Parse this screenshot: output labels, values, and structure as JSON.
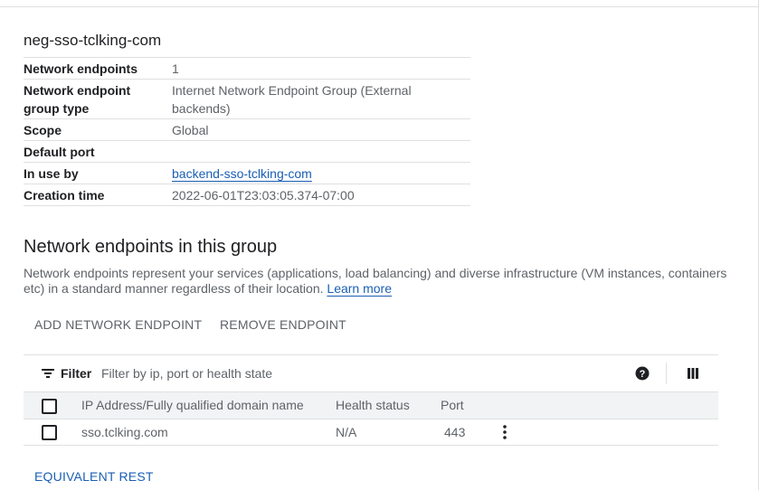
{
  "neg_name": "neg-sso-tclking-com",
  "details": [
    {
      "label": "Network endpoints",
      "value": "1"
    },
    {
      "label": "Network endpoint group type",
      "value": "Internet Network Endpoint Group (External backends)"
    },
    {
      "label": "Scope",
      "value": "Global"
    },
    {
      "label": "Default port",
      "value": ""
    },
    {
      "label": "In use by",
      "value": "backend-sso-tclking-com"
    },
    {
      "label": "Creation time",
      "value": "2022-06-01T23:03:05.374-07:00"
    }
  ],
  "section": {
    "title": "Network endpoints in this group",
    "description": "Network endpoints represent your services (applications, load balancing) and diverse infrastructure (VM instances, containers etc) in a standard manner regardless of their location.",
    "learn_more": "Learn more"
  },
  "actions": {
    "add": "ADD NETWORK ENDPOINT",
    "remove": "REMOVE ENDPOINT"
  },
  "filter": {
    "label": "Filter",
    "placeholder": "Filter by ip, port or health state",
    "icons": {
      "filter": "filter-icon",
      "help": "help-icon",
      "columns": "column-display-icon"
    }
  },
  "table": {
    "columns": [
      "IP Address/Fully qualified domain name",
      "Health status",
      "Port"
    ],
    "rows": [
      {
        "address": "sso.tclking.com",
        "health": "N/A",
        "port": "443"
      }
    ]
  },
  "footer": {
    "equivalent_rest": "EQUIVALENT REST"
  },
  "colors": {
    "link": "#1a5fb4",
    "header_bg": "#f1f3f4",
    "text_primary": "#202124",
    "text_secondary": "#5f6368",
    "border": "#e0e0e0"
  }
}
